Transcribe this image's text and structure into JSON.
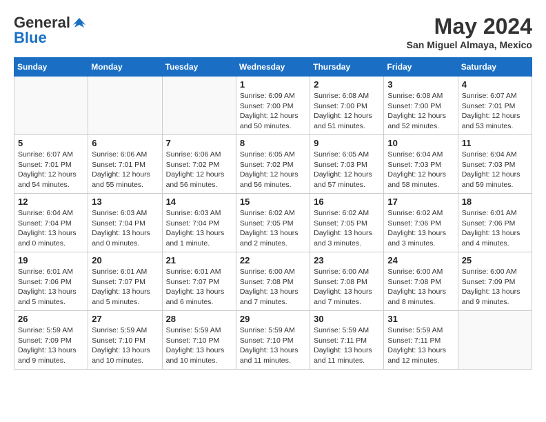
{
  "header": {
    "logo_line1": "General",
    "logo_line2": "Blue",
    "month_year": "May 2024",
    "location": "San Miguel Almaya, Mexico"
  },
  "days_of_week": [
    "Sunday",
    "Monday",
    "Tuesday",
    "Wednesday",
    "Thursday",
    "Friday",
    "Saturday"
  ],
  "weeks": [
    [
      {
        "day": "",
        "info": ""
      },
      {
        "day": "",
        "info": ""
      },
      {
        "day": "",
        "info": ""
      },
      {
        "day": "1",
        "info": "Sunrise: 6:09 AM\nSunset: 7:00 PM\nDaylight: 12 hours\nand 50 minutes."
      },
      {
        "day": "2",
        "info": "Sunrise: 6:08 AM\nSunset: 7:00 PM\nDaylight: 12 hours\nand 51 minutes."
      },
      {
        "day": "3",
        "info": "Sunrise: 6:08 AM\nSunset: 7:00 PM\nDaylight: 12 hours\nand 52 minutes."
      },
      {
        "day": "4",
        "info": "Sunrise: 6:07 AM\nSunset: 7:01 PM\nDaylight: 12 hours\nand 53 minutes."
      }
    ],
    [
      {
        "day": "5",
        "info": "Sunrise: 6:07 AM\nSunset: 7:01 PM\nDaylight: 12 hours\nand 54 minutes."
      },
      {
        "day": "6",
        "info": "Sunrise: 6:06 AM\nSunset: 7:01 PM\nDaylight: 12 hours\nand 55 minutes."
      },
      {
        "day": "7",
        "info": "Sunrise: 6:06 AM\nSunset: 7:02 PM\nDaylight: 12 hours\nand 56 minutes."
      },
      {
        "day": "8",
        "info": "Sunrise: 6:05 AM\nSunset: 7:02 PM\nDaylight: 12 hours\nand 56 minutes."
      },
      {
        "day": "9",
        "info": "Sunrise: 6:05 AM\nSunset: 7:03 PM\nDaylight: 12 hours\nand 57 minutes."
      },
      {
        "day": "10",
        "info": "Sunrise: 6:04 AM\nSunset: 7:03 PM\nDaylight: 12 hours\nand 58 minutes."
      },
      {
        "day": "11",
        "info": "Sunrise: 6:04 AM\nSunset: 7:03 PM\nDaylight: 12 hours\nand 59 minutes."
      }
    ],
    [
      {
        "day": "12",
        "info": "Sunrise: 6:04 AM\nSunset: 7:04 PM\nDaylight: 13 hours\nand 0 minutes."
      },
      {
        "day": "13",
        "info": "Sunrise: 6:03 AM\nSunset: 7:04 PM\nDaylight: 13 hours\nand 0 minutes."
      },
      {
        "day": "14",
        "info": "Sunrise: 6:03 AM\nSunset: 7:04 PM\nDaylight: 13 hours\nand 1 minute."
      },
      {
        "day": "15",
        "info": "Sunrise: 6:02 AM\nSunset: 7:05 PM\nDaylight: 13 hours\nand 2 minutes."
      },
      {
        "day": "16",
        "info": "Sunrise: 6:02 AM\nSunset: 7:05 PM\nDaylight: 13 hours\nand 3 minutes."
      },
      {
        "day": "17",
        "info": "Sunrise: 6:02 AM\nSunset: 7:06 PM\nDaylight: 13 hours\nand 3 minutes."
      },
      {
        "day": "18",
        "info": "Sunrise: 6:01 AM\nSunset: 7:06 PM\nDaylight: 13 hours\nand 4 minutes."
      }
    ],
    [
      {
        "day": "19",
        "info": "Sunrise: 6:01 AM\nSunset: 7:06 PM\nDaylight: 13 hours\nand 5 minutes."
      },
      {
        "day": "20",
        "info": "Sunrise: 6:01 AM\nSunset: 7:07 PM\nDaylight: 13 hours\nand 5 minutes."
      },
      {
        "day": "21",
        "info": "Sunrise: 6:01 AM\nSunset: 7:07 PM\nDaylight: 13 hours\nand 6 minutes."
      },
      {
        "day": "22",
        "info": "Sunrise: 6:00 AM\nSunset: 7:08 PM\nDaylight: 13 hours\nand 7 minutes."
      },
      {
        "day": "23",
        "info": "Sunrise: 6:00 AM\nSunset: 7:08 PM\nDaylight: 13 hours\nand 7 minutes."
      },
      {
        "day": "24",
        "info": "Sunrise: 6:00 AM\nSunset: 7:08 PM\nDaylight: 13 hours\nand 8 minutes."
      },
      {
        "day": "25",
        "info": "Sunrise: 6:00 AM\nSunset: 7:09 PM\nDaylight: 13 hours\nand 9 minutes."
      }
    ],
    [
      {
        "day": "26",
        "info": "Sunrise: 5:59 AM\nSunset: 7:09 PM\nDaylight: 13 hours\nand 9 minutes."
      },
      {
        "day": "27",
        "info": "Sunrise: 5:59 AM\nSunset: 7:10 PM\nDaylight: 13 hours\nand 10 minutes."
      },
      {
        "day": "28",
        "info": "Sunrise: 5:59 AM\nSunset: 7:10 PM\nDaylight: 13 hours\nand 10 minutes."
      },
      {
        "day": "29",
        "info": "Sunrise: 5:59 AM\nSunset: 7:10 PM\nDaylight: 13 hours\nand 11 minutes."
      },
      {
        "day": "30",
        "info": "Sunrise: 5:59 AM\nSunset: 7:11 PM\nDaylight: 13 hours\nand 11 minutes."
      },
      {
        "day": "31",
        "info": "Sunrise: 5:59 AM\nSunset: 7:11 PM\nDaylight: 13 hours\nand 12 minutes."
      },
      {
        "day": "",
        "info": ""
      }
    ]
  ]
}
